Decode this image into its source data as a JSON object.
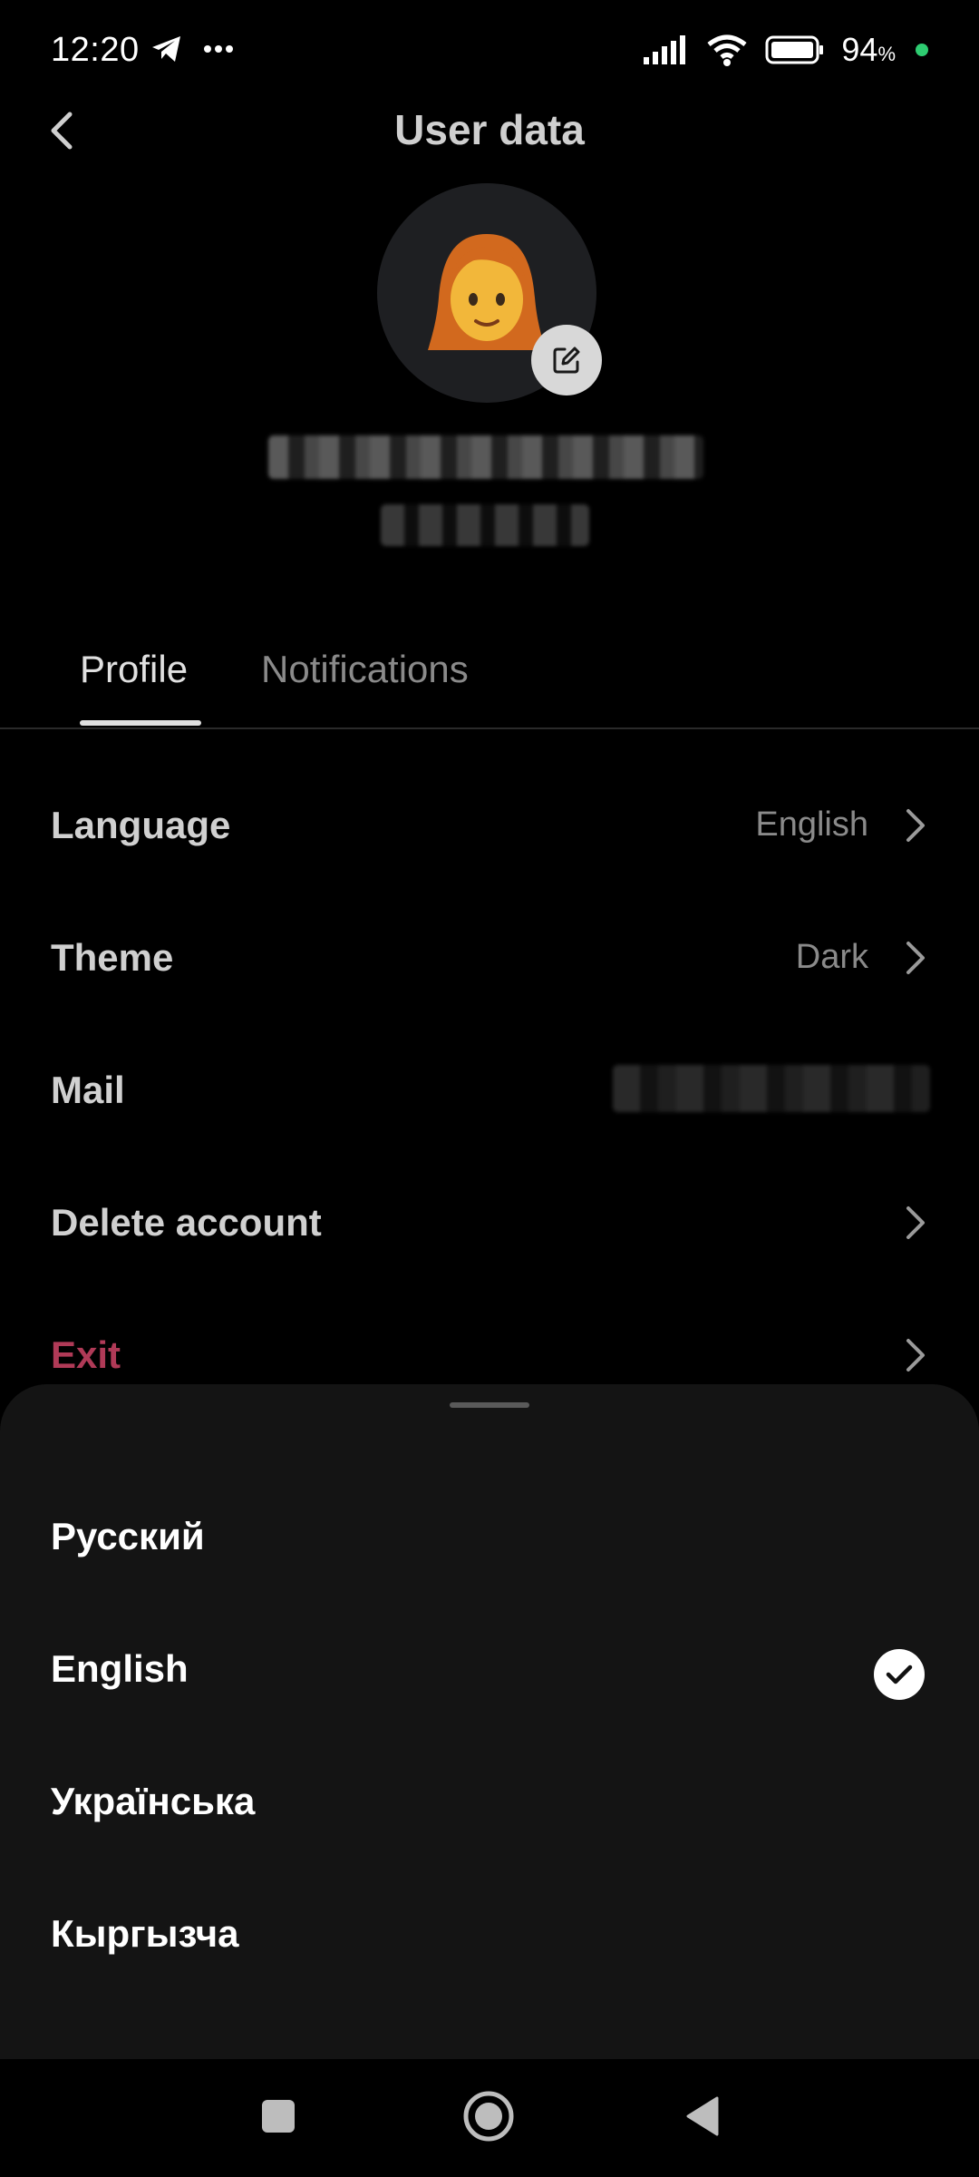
{
  "status_bar": {
    "time": "12:20",
    "battery_percent": "94",
    "battery_unit": "%",
    "icons": [
      "telegram-icon",
      "more-dots-icon",
      "signal-icon",
      "wifi-icon",
      "battery-icon"
    ]
  },
  "header": {
    "title": "User data",
    "back_icon": "chevron-left-icon"
  },
  "profile": {
    "avatar_emoji": "👩",
    "edit_icon": "edit-icon"
  },
  "tabs": [
    {
      "label": "Profile",
      "active": true
    },
    {
      "label": "Notifications",
      "active": false
    }
  ],
  "settings": {
    "language": {
      "label": "Language",
      "value": "English"
    },
    "theme": {
      "label": "Theme",
      "value": "Dark"
    },
    "mail": {
      "label": "Mail"
    },
    "delete_account": {
      "label": "Delete account"
    },
    "exit": {
      "label": "Exit"
    }
  },
  "language_sheet": {
    "options": [
      {
        "label": "Русский",
        "selected": false
      },
      {
        "label": "English",
        "selected": true
      },
      {
        "label": "Українська",
        "selected": false
      },
      {
        "label": "Кыргызча",
        "selected": false
      }
    ]
  },
  "colors": {
    "background": "#000000",
    "sheet": "#141414",
    "exit_accent": "#b03a57",
    "online_dot": "#2ecc71"
  }
}
